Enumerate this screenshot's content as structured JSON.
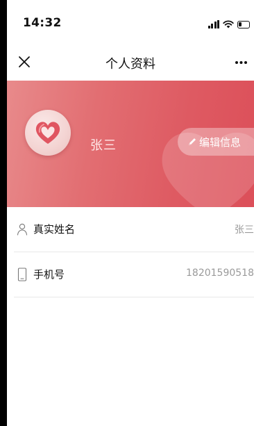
{
  "status_bar": {
    "time": "14:32",
    "icons": [
      "signal-icon",
      "wifi-icon",
      "battery-icon"
    ]
  },
  "nav": {
    "title": "个人资料",
    "left_icon": "close-icon",
    "right_icon": "more-icon"
  },
  "profile": {
    "name": "张三",
    "avatar_icon": "heart-logo-icon",
    "edit_label": "编辑信息",
    "edit_icon": "pencil-icon"
  },
  "info_rows": [
    {
      "icon": "person-icon",
      "label": "真实姓名",
      "value": "张三"
    },
    {
      "icon": "phone-icon",
      "label": "手机号",
      "value": "18201590518"
    }
  ],
  "colors": {
    "banner_start": "#e88a8b",
    "banner_end": "#dc4f59",
    "label_text": "#111111",
    "value_text": "#9a9a9a"
  }
}
